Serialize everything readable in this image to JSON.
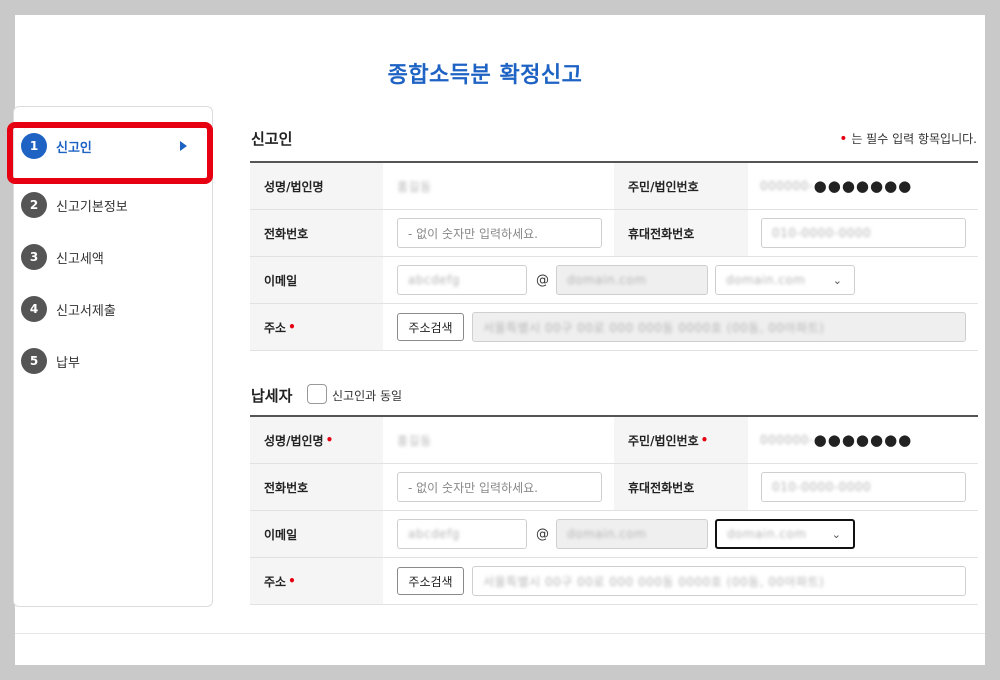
{
  "page_title": "종합소득분 확정신고",
  "steps": [
    {
      "num": "1",
      "label": "신고인"
    },
    {
      "num": "2",
      "label": "신고기본정보"
    },
    {
      "num": "3",
      "label": "신고세액"
    },
    {
      "num": "4",
      "label": "신고서제출"
    },
    {
      "num": "5",
      "label": "납부"
    }
  ],
  "required_note": "는 필수 입력 항목입니다.",
  "required_mark": "•",
  "reporter": {
    "title": "신고인",
    "name_label": "성명/법인명",
    "name_value": "홍길동",
    "id_label": "주민/법인번호",
    "id_prefix": "000000-",
    "id_masked": "●●●●●●●",
    "phone_label": "전화번호",
    "phone_placeholder": "- 없이 숫자만 입력하세요.",
    "mobile_label": "휴대전화번호",
    "mobile_value": "010-0000-0000",
    "email_label": "이메일",
    "email_id": "abcdefg",
    "at": "@",
    "email_domain": "domain.com",
    "email_select": "domain.com",
    "address_label": "주소",
    "address_button": "주소검색",
    "address_value": "서울특별시 00구 00로 000 000동 0000호 (00동, 00아파트)"
  },
  "taxpayer": {
    "title": "납세자",
    "same_label": "신고인과 동일",
    "name_label": "성명/법인명",
    "name_value": "홍길동",
    "id_label": "주민/법인번호",
    "id_prefix": "000000-",
    "id_masked": "●●●●●●●",
    "phone_label": "전화번호",
    "phone_placeholder": "- 없이 숫자만 입력하세요.",
    "mobile_label": "휴대전화번호",
    "mobile_value": "010-0000-0000",
    "email_label": "이메일",
    "email_id": "abcdefg",
    "at": "@",
    "email_domain": "domain.com",
    "email_select": "domain.com",
    "address_label": "주소",
    "address_button": "주소검색",
    "address_value": "서울특별시 00구 00로 000 000동 0000호 (00동, 00아파트)"
  },
  "colors": {
    "accent": "#1e63c4",
    "required": "#e60012",
    "highlight": "#e60012"
  }
}
